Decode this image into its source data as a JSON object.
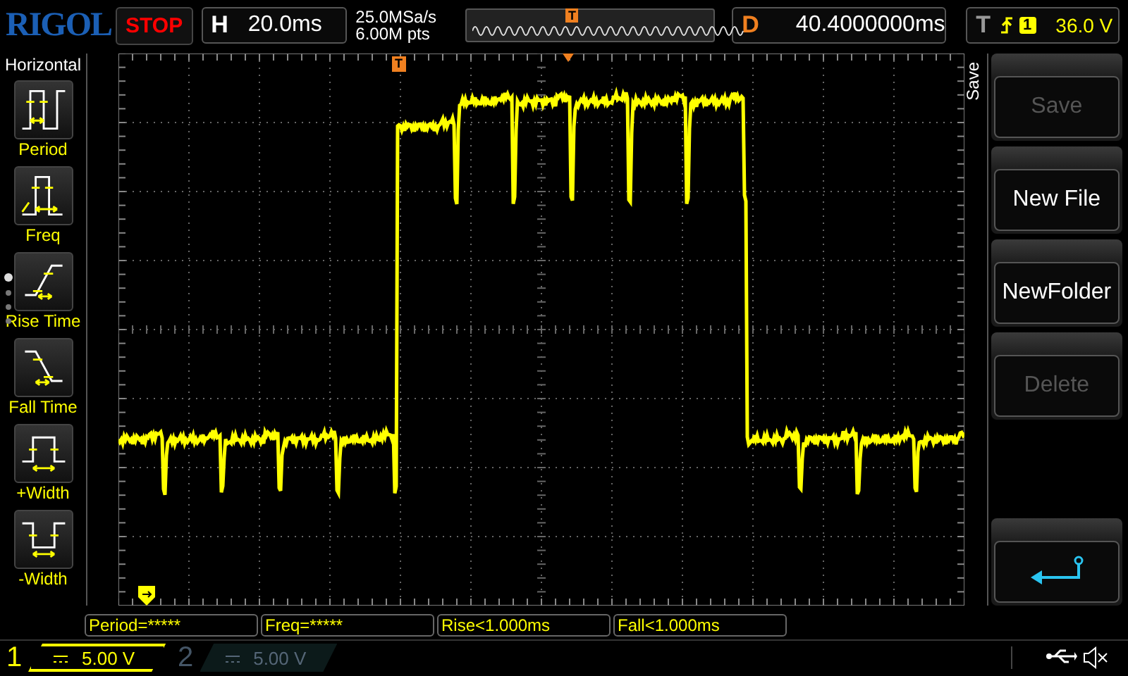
{
  "logo": "RIGOL",
  "run_state": "STOP",
  "timebase": {
    "label": "H",
    "value": "20.0ms"
  },
  "acquisition": {
    "sample_rate": "25.0MSa/s",
    "memory_depth": "6.00M pts"
  },
  "timeline_marker": "T",
  "delay": {
    "label": "D",
    "value": "40.4000000ms"
  },
  "trigger": {
    "label": "T",
    "channel": "1",
    "level": "36.0 V"
  },
  "sidebar": {
    "title": "Horizontal",
    "items": [
      {
        "label": "Period",
        "kind": "period"
      },
      {
        "label": "Freq",
        "kind": "freq"
      },
      {
        "label": "Rise Time",
        "kind": "rise"
      },
      {
        "label": "Fall Time",
        "kind": "fall"
      },
      {
        "label": "+Width",
        "kind": "pwidth"
      },
      {
        "label": "-Width",
        "kind": "nwidth"
      }
    ]
  },
  "grid_trigger_marker": "T",
  "menu": {
    "title": "Save",
    "buttons": [
      {
        "kind": "text",
        "label": "Save",
        "disabled": true
      },
      {
        "kind": "text",
        "label": "New File",
        "disabled": false
      },
      {
        "kind": "text",
        "label": "NewFolder",
        "disabled": false
      },
      {
        "kind": "text",
        "label": "Delete",
        "disabled": true
      },
      {
        "kind": "spacer"
      },
      {
        "kind": "return"
      }
    ]
  },
  "measurements": [
    "Period=*****",
    "Freq=*****",
    "Rise<1.000ms",
    "Fall<1.000ms"
  ],
  "channels": [
    {
      "number": "1",
      "scale": "5.00 V",
      "on": true
    },
    {
      "number": "2",
      "scale": "5.00 V",
      "on": false
    }
  ]
}
